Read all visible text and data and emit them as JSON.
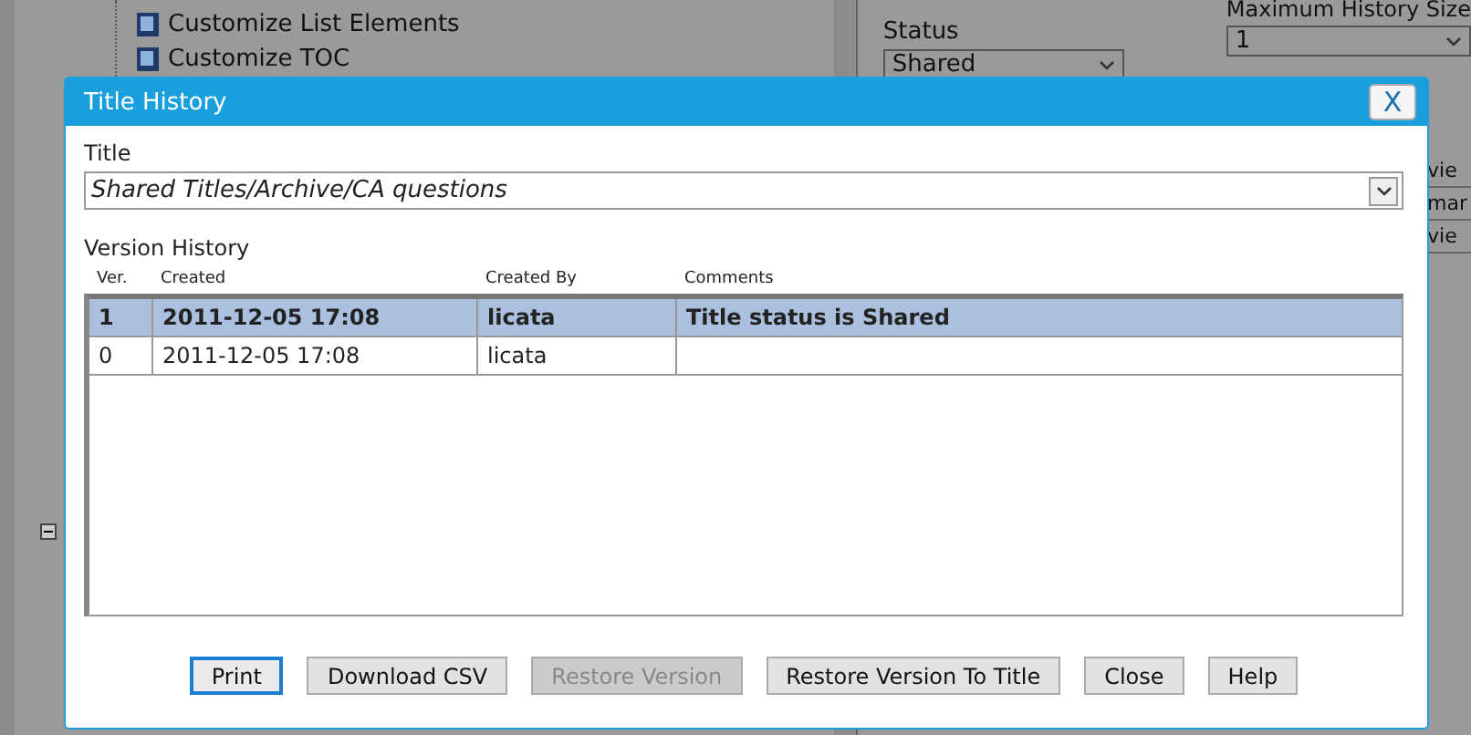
{
  "background": {
    "tree_items": [
      {
        "label": "Customize List Elements"
      },
      {
        "label": "Customize TOC"
      }
    ],
    "status": {
      "label": "Status",
      "value": "Shared"
    },
    "history_size": {
      "label": "Maximum History Size",
      "value": "1"
    },
    "side_list": [
      "vie",
      "mar",
      "vie"
    ]
  },
  "dialog": {
    "title": "Title History",
    "close": "X",
    "title_field": {
      "label": "Title",
      "value": "Shared Titles/Archive/CA questions"
    },
    "history": {
      "label": "Version History",
      "columns": [
        "Ver.",
        "Created",
        "Created By",
        "Comments"
      ],
      "rows": [
        {
          "cells": [
            "1",
            "2011-12-05 17:08",
            "licata",
            "Title status is Shared"
          ],
          "selected": true
        },
        {
          "cells": [
            "0",
            "2011-12-05 17:08",
            "licata",
            ""
          ],
          "selected": false
        }
      ]
    },
    "buttons": [
      {
        "label": "Print",
        "focused": true,
        "disabled": false
      },
      {
        "label": "Download CSV",
        "focused": false,
        "disabled": false
      },
      {
        "label": "Restore Version",
        "focused": false,
        "disabled": true
      },
      {
        "label": "Restore Version To Title",
        "focused": false,
        "disabled": false
      },
      {
        "label": "Close",
        "focused": false,
        "disabled": false
      },
      {
        "label": "Help",
        "focused": false,
        "disabled": false
      }
    ]
  }
}
